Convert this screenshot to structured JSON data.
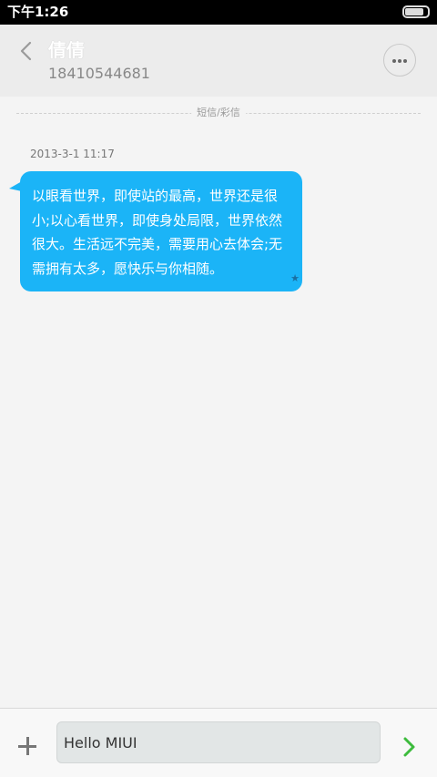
{
  "status_bar": {
    "time": "下午1:26",
    "battery_level": 0.85
  },
  "header": {
    "contact_name": "倩倩",
    "contact_number": "18410544681"
  },
  "divider_label": "短信/彩信",
  "messages": [
    {
      "timestamp": "2013-3-1 11:17",
      "text": "以眼看世界，即使站的最高，世界还是很小;以心看世界，即使身处局限，世界依然很大。生活远不完美，需要用心去体会;无需拥有太多，愿快乐与你相随。",
      "starred": true,
      "star_glyph": "★"
    }
  ],
  "composer": {
    "input_value": "Hello MIUI"
  },
  "colors": {
    "bubble": "#1bb4f7",
    "send_icon": "#3dbb3d",
    "header_bg": "#ececec",
    "page_bg": "#f4f4f4"
  }
}
